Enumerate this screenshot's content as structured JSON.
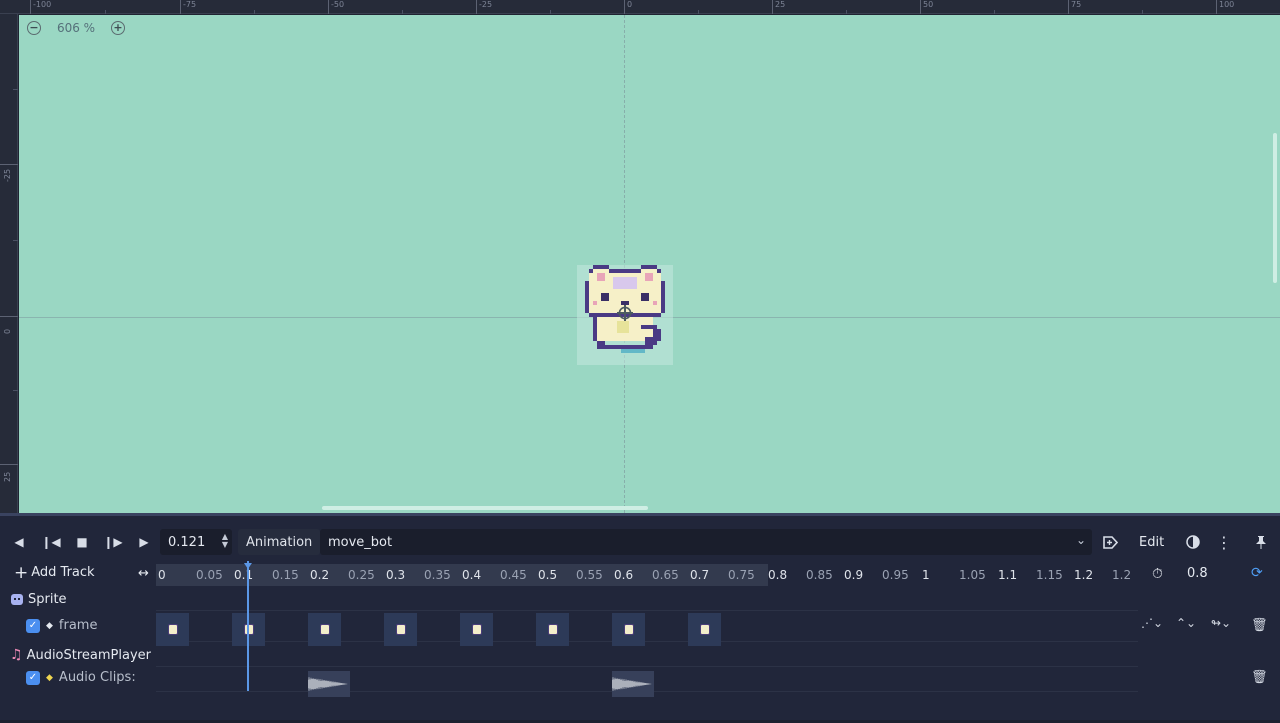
{
  "viewport": {
    "ruler_top_labels": [
      "-100",
      "-75",
      "-50",
      "-25",
      "0",
      "25",
      "50",
      "75",
      "100"
    ],
    "ruler_left_labels": [
      "-25",
      "0",
      "25"
    ],
    "zoom": {
      "level": "606 %",
      "minus_icon": "zoom-out-icon",
      "plus_icon": "zoom-in-icon"
    },
    "canvas_color": "#9ad7c3"
  },
  "toolbar": {
    "time_value": "0.121",
    "animation_label": "Animation",
    "animation_name": "move_bot",
    "edit_label": "Edit",
    "icons": [
      "play-backward-icon",
      "step-backward-icon",
      "stop-icon",
      "step-forward-icon",
      "play-icon"
    ]
  },
  "timeline": {
    "add_track_label": "Add Track",
    "ticks": [
      "0",
      "0.05",
      "0.1",
      "0.15",
      "0.2",
      "0.25",
      "0.3",
      "0.35",
      "0.4",
      "0.45",
      "0.5",
      "0.55",
      "0.6",
      "0.65",
      "0.7",
      "0.75",
      "0.8",
      "0.85",
      "0.9",
      "0.95",
      "1",
      "1.05",
      "1.1",
      "1.15",
      "1.2",
      "1.2"
    ],
    "length_value": "0.8",
    "playhead_time": 0.121,
    "accent": "#5b97e6"
  },
  "tracks": {
    "sprite_group": "Sprite",
    "sprite_track": "frame",
    "sprite_keys": [
      0,
      0.1,
      0.2,
      0.3,
      0.4,
      0.5,
      0.6,
      0.7
    ],
    "audio_group": "AudioStreamPlayer",
    "audio_track": "Audio Clips:",
    "audio_clips": [
      0.2,
      0.6
    ]
  }
}
